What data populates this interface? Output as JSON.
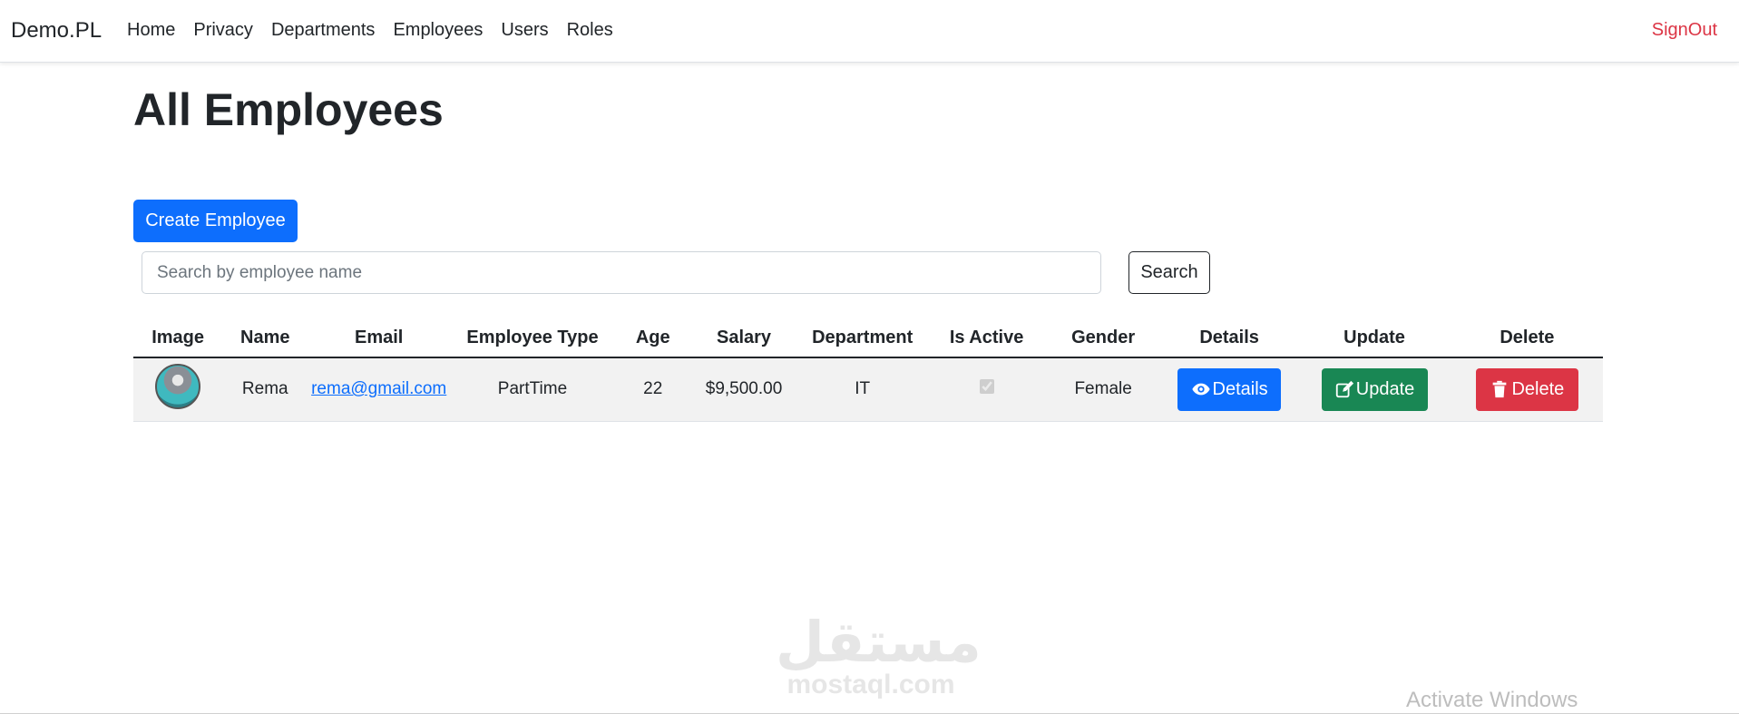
{
  "navbar": {
    "brand": "Demo.PL",
    "links": [
      "Home",
      "Privacy",
      "Departments",
      "Employees",
      "Users",
      "Roles"
    ],
    "signout": "SignOut"
  },
  "page": {
    "title": "All Employees",
    "create_button": "Create Employee",
    "search_placeholder": "Search by employee name",
    "search_button": "Search"
  },
  "table": {
    "headers": [
      "Image",
      "Name",
      "Email",
      "Employee Type",
      "Age",
      "Salary",
      "Department",
      "Is Active",
      "Gender",
      "Details",
      "Update",
      "Delete"
    ],
    "rows": [
      {
        "name": "Rema",
        "email": "rema@gmail.com",
        "employee_type": "PartTime",
        "age": "22",
        "salary": "$9,500.00",
        "department": "IT",
        "is_active": true,
        "gender": "Female",
        "details_label": "Details",
        "update_label": "Update",
        "delete_label": "Delete"
      }
    ]
  },
  "colors": {
    "primary": "#0d6efd",
    "success": "#198754",
    "danger": "#dc3545"
  },
  "overlay": {
    "watermark_arabic": "مستقل",
    "watermark_latin": "mostaql.com",
    "activate_windows": "Activate Windows"
  }
}
